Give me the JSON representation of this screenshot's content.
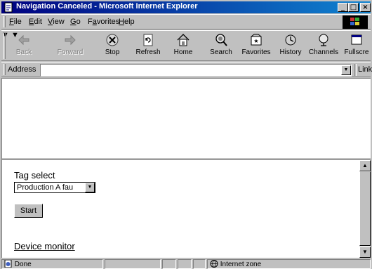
{
  "window": {
    "title": "Navigation Canceled - Microsoft Internet Explorer",
    "minimize": "_",
    "maximize": "□",
    "close": "×"
  },
  "menu": {
    "items": [
      {
        "label": "File",
        "key": "F",
        "rest": "ile"
      },
      {
        "label": "Edit",
        "key": "E",
        "rest": "dit"
      },
      {
        "label": "View",
        "key": "V",
        "rest": "iew"
      },
      {
        "label": "Go",
        "key": "G",
        "rest": "o"
      },
      {
        "label": "Favorites",
        "key": "a",
        "pre": "F",
        "rest": "vorites"
      },
      {
        "label": "Help",
        "key": "H",
        "rest": "elp"
      }
    ]
  },
  "toolbar": {
    "back": "Back",
    "forward": "Forward",
    "stop": "Stop",
    "refresh": "Refresh",
    "home": "Home",
    "search": "Search",
    "favorites": "Favorites",
    "history": "History",
    "channels": "Channels",
    "fullscreen": "Fullscre"
  },
  "address": {
    "label": "Address",
    "value": "",
    "links_label": "Links"
  },
  "page": {
    "tag_select_label": "Tag select",
    "tag_select_value": "Production A fau",
    "start_label": "Start",
    "device_monitor_link": "Device monitor"
  },
  "status": {
    "text": "Done",
    "zone": "Internet zone"
  },
  "icons": {
    "app": "ie-page-icon",
    "back": "back-arrow-icon",
    "forward": "forward-arrow-icon",
    "stop": "stop-icon",
    "refresh": "refresh-icon",
    "home": "home-icon",
    "search": "search-icon",
    "favorites": "favorites-icon",
    "history": "history-icon",
    "channels": "channels-icon",
    "fullscreen": "fullscreen-icon",
    "zone": "internet-zone-icon"
  }
}
